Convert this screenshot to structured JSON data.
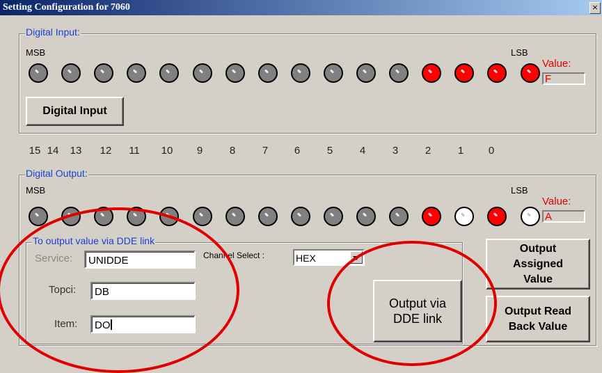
{
  "window": {
    "title": "Setting Configuration for 7060",
    "close_glyph": "×"
  },
  "digital_input": {
    "legend": "Digital Input:",
    "msb": "MSB",
    "lsb": "LSB",
    "value_label": "Value:",
    "value": "F",
    "button_label": "Digital Input",
    "leds": [
      "off",
      "off",
      "off",
      "off",
      "off",
      "off",
      "off",
      "off",
      "off",
      "off",
      "off",
      "off",
      "on",
      "on",
      "on",
      "on"
    ]
  },
  "bit_numbers": [
    "15",
    "14",
    "13",
    "12",
    "11",
    "10",
    "9",
    "8",
    "7",
    "6",
    "5",
    "4",
    "3",
    "2",
    "1",
    "0"
  ],
  "digital_output": {
    "legend": "Digital Output:",
    "msb": "MSB",
    "lsb": "LSB",
    "value_label": "Value:",
    "value": "A",
    "leds": [
      "off",
      "off",
      "off",
      "off",
      "off",
      "off",
      "off",
      "off",
      "off",
      "off",
      "off",
      "off",
      "on",
      "white",
      "on",
      "white"
    ]
  },
  "dde": {
    "legend": "To output value via DDE link",
    "service_label": "Service:",
    "service_value": "UNIDDE",
    "topic_label": "Topci:",
    "topic_value": "DB",
    "item_label": "Item:",
    "item_value": "DO",
    "channel_label": "Channel Select :",
    "channel_value": "HEX",
    "output_button": "Output via DDE link"
  },
  "buttons": {
    "output_assigned": "Output Assigned Value",
    "output_read_back": "Output Read Back Value"
  },
  "colors": {
    "led_on": "#ff0000",
    "led_off": "#808080",
    "led_white": "#ffffff",
    "annotation": "#e00000"
  }
}
